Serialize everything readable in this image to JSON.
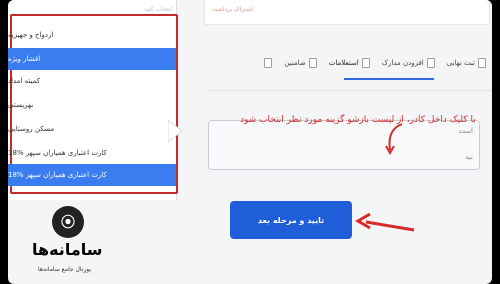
{
  "inner_top": {
    "hint": "اشتراک برداشت"
  },
  "steps": [
    {
      "label": "ثبت نهایی"
    },
    {
      "label": "افزودن مدارک"
    },
    {
      "label": "استعلامات"
    },
    {
      "label": "ضامنین"
    },
    {
      "label": ""
    }
  ],
  "instruction": "با کلیک داخل کادر، از لیست بازشو گزینه مورد نظر انتخاب شود",
  "field": {
    "label_1": "است",
    "label_2": "نید"
  },
  "submit_button": {
    "label": "تایید و مرحله بعد"
  },
  "dropdown": {
    "title": "انتخاب کنید",
    "items": [
      {
        "label": "ازدواج و جهیزیه"
      },
      {
        "label": "اقشار ویژه"
      },
      {
        "label": "کمیته امداد"
      },
      {
        "label": "بهزیستی"
      },
      {
        "label": "مسکن روستایی"
      },
      {
        "label": "کارت اعتباری همیاران سپهر %18"
      },
      {
        "label": "کارت اعتباری همیاران سپهر %18"
      }
    ]
  },
  "logo": {
    "brand": "سامانه‌ها",
    "sub": "پورتال جامع سامانه‌ها"
  },
  "colors": {
    "accent": "#1f5ed8",
    "highlight": "#c52a2a",
    "selected": "#3b7cf0"
  }
}
